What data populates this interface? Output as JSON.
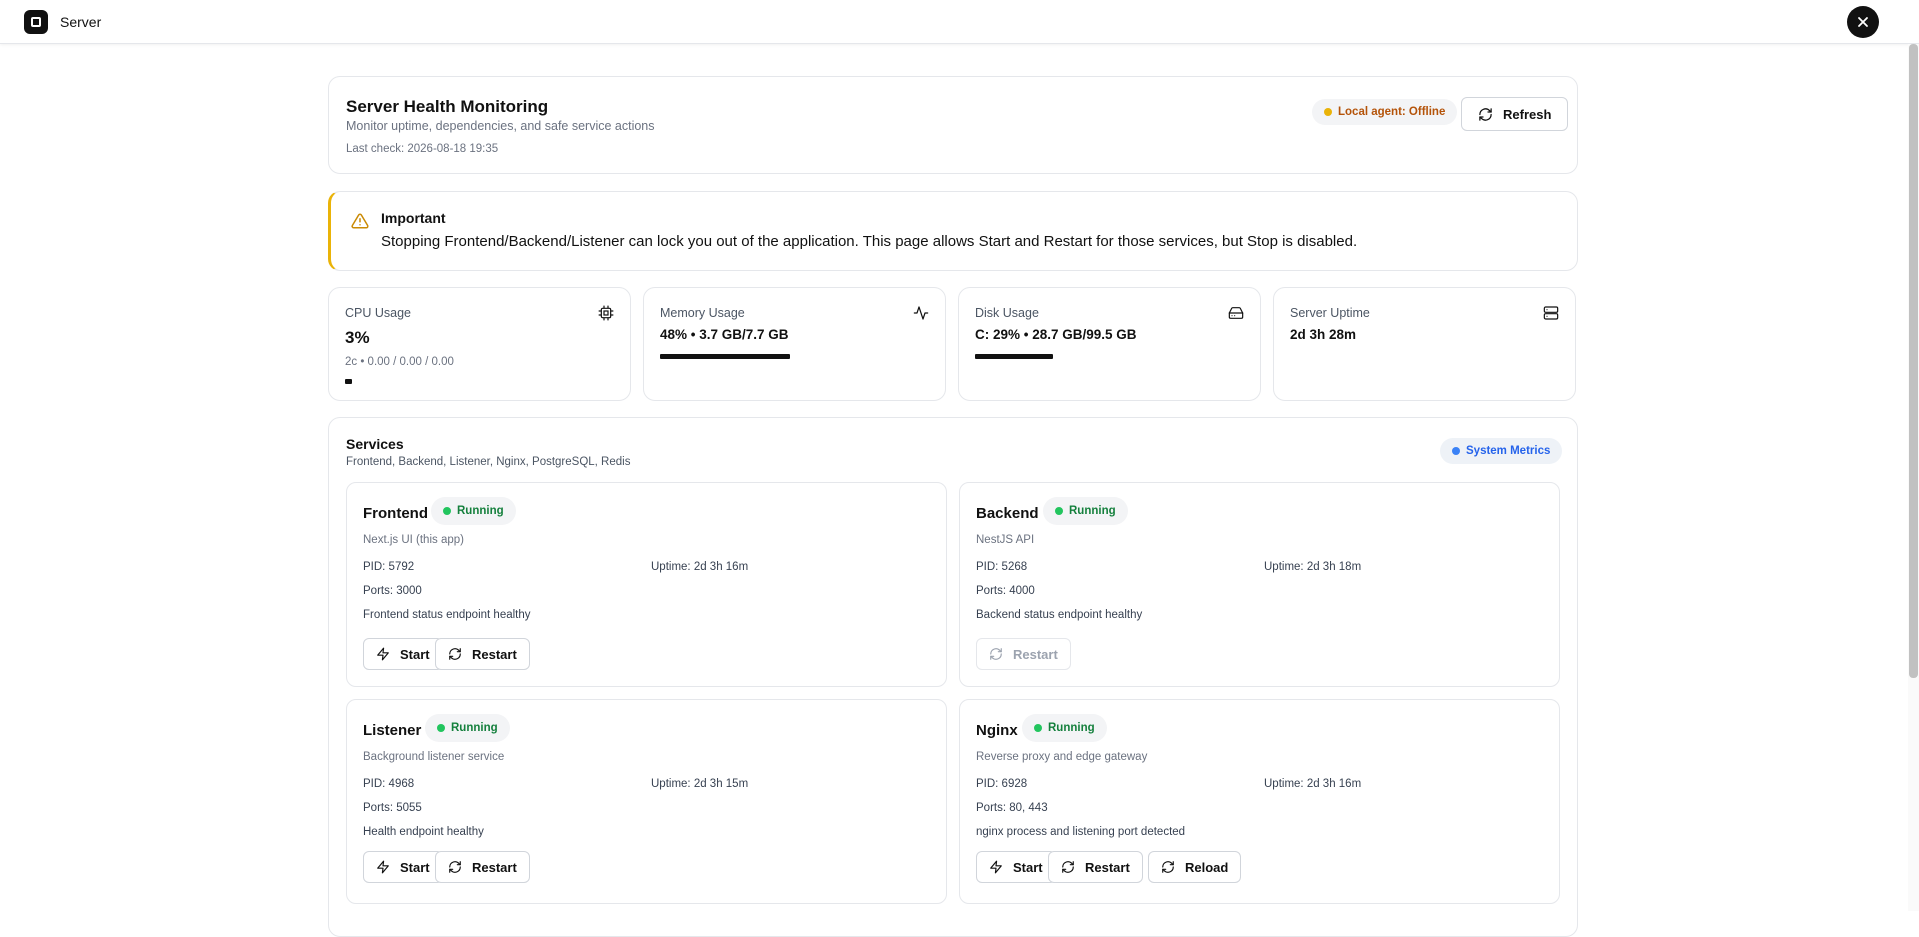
{
  "app": {
    "title": "Server"
  },
  "header": {
    "title": "Server Health Monitoring",
    "subtitle": "Monitor uptime, dependencies, and safe service actions",
    "last_check": "Last check: 2026-08-18 19:35",
    "agent_status": "Local agent: Offline",
    "agent_color": "#eab308",
    "refresh_label": "Refresh"
  },
  "warning": {
    "title": "Important",
    "text": "Stopping Frontend/Backend/Listener can lock you out of the application. This page allows Start and Restart for those services, but Stop is disabled."
  },
  "metrics": {
    "cpu": {
      "label": "CPU Usage",
      "value": "3%",
      "sub": "2c • 0.00 / 0.00 / 0.00",
      "percent": 3,
      "icon": "cpu-icon"
    },
    "memory": {
      "label": "Memory Usage",
      "value": "48% • 3.7 GB/7.7 GB",
      "percent": 48,
      "icon": "activity-icon"
    },
    "disk": {
      "label": "Disk Usage",
      "value": "C: 29% • 28.7 GB/99.5 GB",
      "percent": 29,
      "icon": "hard-drive-icon"
    },
    "uptime": {
      "label": "Server Uptime",
      "value": "2d 3h 28m",
      "icon": "server-icon"
    }
  },
  "services": {
    "title": "Services",
    "subtitle": "Frontend, Backend, Listener, Nginx, PostgreSQL, Redis",
    "badge": "System Metrics",
    "badge_color": "#3b82f6",
    "running_color": "#22c55e",
    "items": [
      {
        "name": "Frontend",
        "status": "Running",
        "desc": "Next.js UI (this app)",
        "pid": "PID: 5792",
        "uptime": "Uptime: 2d 3h 16m",
        "ports": "Ports: 3000",
        "health": "Frontend status endpoint healthy",
        "start": "Start",
        "restart": "Restart"
      },
      {
        "name": "Backend",
        "status": "Running",
        "desc": "NestJS API",
        "pid": "PID: 5268",
        "uptime": "Uptime: 2d 3h 18m",
        "ports": "Ports: 4000",
        "health": "Backend status endpoint healthy",
        "restart": "Restart"
      },
      {
        "name": "Listener",
        "status": "Running",
        "desc": "Background listener service",
        "pid": "PID: 4968",
        "uptime": "Uptime: 2d 3h 15m",
        "ports": "Ports: 5055",
        "health": "Health endpoint healthy",
        "start": "Start",
        "restart": "Restart"
      },
      {
        "name": "Nginx",
        "status": "Running",
        "desc": "Reverse proxy and edge gateway",
        "pid": "PID: 6928",
        "uptime": "Uptime: 2d 3h 16m",
        "ports": "Ports: 80, 443",
        "health": "nginx process and listening port detected",
        "start": "Start",
        "restart": "Restart",
        "reload": "Reload"
      }
    ]
  }
}
